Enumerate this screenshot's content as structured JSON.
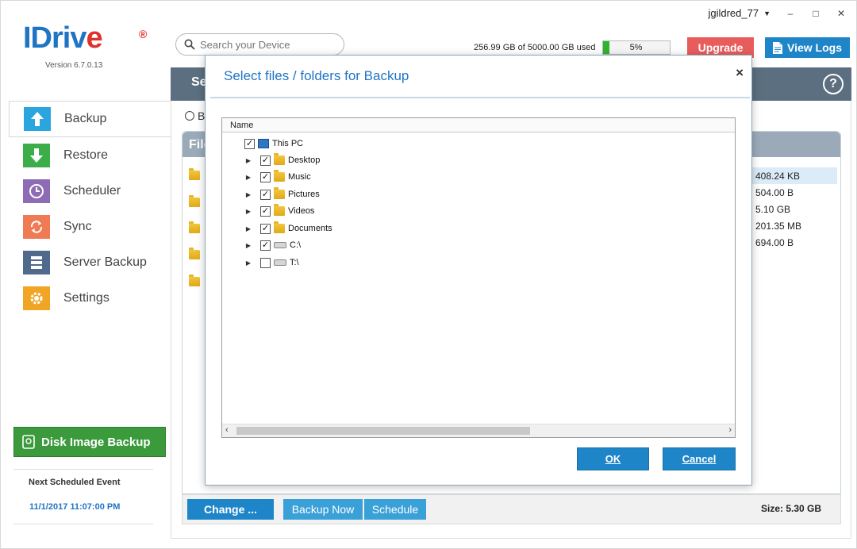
{
  "titlebar": {
    "username": "jgildred_77",
    "minimize": "–",
    "maximize": "□",
    "close": "✕"
  },
  "logo": {
    "brand": "IDriv",
    "brand_e": "e",
    "reg": "®",
    "version": "Version  6.7.0.13"
  },
  "search": {
    "placeholder": "Search your Device"
  },
  "usage": {
    "text": "256.99 GB of 5000.00 GB used",
    "percent_label": "5%",
    "percent": 5
  },
  "header_buttons": {
    "upgrade": "Upgrade",
    "view_logs": "View Logs"
  },
  "sidebar": {
    "items": [
      {
        "label": "Backup",
        "icon": "backup-icon",
        "color": "#2aa5de"
      },
      {
        "label": "Restore",
        "icon": "restore-icon",
        "color": "#3bae4a"
      },
      {
        "label": "Scheduler",
        "icon": "scheduler-icon",
        "color": "#8e6bb5"
      },
      {
        "label": "Sync",
        "icon": "sync-icon",
        "color": "#ef7a53"
      },
      {
        "label": "Server Backup",
        "icon": "server-icon",
        "color": "#4f6a8c"
      },
      {
        "label": "Settings",
        "icon": "settings-icon",
        "color": "#f0a524"
      }
    ],
    "disk_image_backup": "Disk Image Backup",
    "next_event_label": "Next Scheduled Event",
    "next_event_date": "11/1/2017 11:07:00 PM"
  },
  "main": {
    "header_partial": "Se",
    "radio_partial": "B",
    "files_header_partial": "File",
    "sizes": [
      "408.24 KB",
      "504.00 B",
      "5.10 GB",
      "201.35 MB",
      "694.00 B"
    ],
    "total_size": "Size: 5.30 GB",
    "buttons": {
      "change": "Change ...",
      "backup_now": "Backup Now",
      "schedule": "Schedule"
    },
    "help": "?"
  },
  "dialog": {
    "title": "Select files / folders for Backup",
    "close": "×",
    "column_name": "Name",
    "tree": {
      "root": {
        "label": "This PC",
        "checked": true
      },
      "children": [
        {
          "label": "Desktop",
          "checked": true,
          "type": "folder"
        },
        {
          "label": "Music",
          "checked": true,
          "type": "folder"
        },
        {
          "label": "Pictures",
          "checked": true,
          "type": "folder"
        },
        {
          "label": "Videos",
          "checked": true,
          "type": "folder"
        },
        {
          "label": "Documents",
          "checked": true,
          "type": "folder"
        },
        {
          "label": "C:\\",
          "checked": true,
          "type": "drive"
        },
        {
          "label": "T:\\",
          "checked": false,
          "type": "drive"
        }
      ]
    },
    "ok": "OK",
    "cancel": "Cancel"
  }
}
